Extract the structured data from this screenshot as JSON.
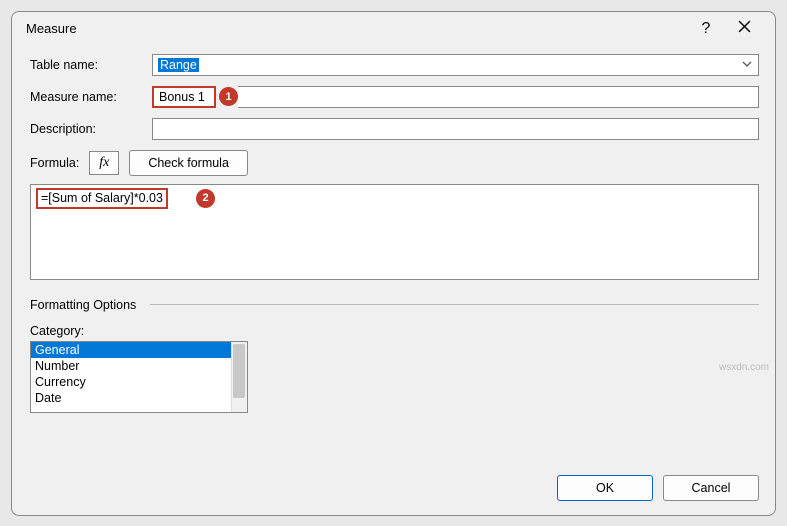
{
  "dialog": {
    "title": "Measure",
    "help_symbol": "?",
    "close_label": "Close"
  },
  "fields": {
    "table_name_label": "Table name:",
    "table_name_value": "Range",
    "measure_name_label": "Measure name:",
    "measure_name_value": "Bonus 1",
    "description_label": "Description:",
    "description_value": "",
    "formula_label": "Formula:",
    "fx_label": "fx",
    "check_formula_label": "Check formula",
    "formula_value": "=[Sum of Salary]*0.03"
  },
  "callouts": {
    "one": "1",
    "two": "2"
  },
  "formatting": {
    "header": "Formatting Options",
    "category_label": "Category:",
    "items": [
      "General",
      "Number",
      "Currency",
      "Date"
    ],
    "selected_index": 0
  },
  "footer": {
    "ok": "OK",
    "cancel": "Cancel"
  },
  "watermark": "wsxdn.com"
}
